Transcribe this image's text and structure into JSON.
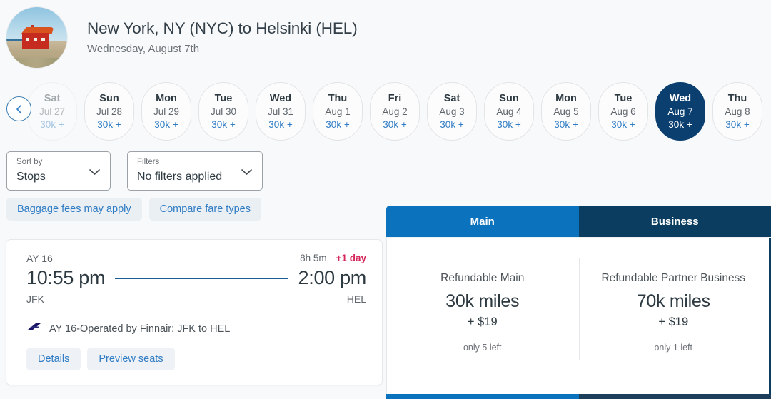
{
  "header": {
    "avatar_alt": "red-cabin-beach-photo",
    "route_title": "New York, NY (NYC) to Helsinki (HEL)",
    "route_date": "Wednesday, August 7th"
  },
  "carousel": {
    "prev_icon": "chevron-left-icon",
    "dates": [
      {
        "dow": "Sat",
        "day": "Jul 27",
        "price": "30k +",
        "selected": false,
        "faded": true
      },
      {
        "dow": "Sun",
        "day": "Jul 28",
        "price": "30k +",
        "selected": false,
        "faded": false
      },
      {
        "dow": "Mon",
        "day": "Jul 29",
        "price": "30k +",
        "selected": false,
        "faded": false
      },
      {
        "dow": "Tue",
        "day": "Jul 30",
        "price": "30k +",
        "selected": false,
        "faded": false
      },
      {
        "dow": "Wed",
        "day": "Jul 31",
        "price": "30k +",
        "selected": false,
        "faded": false
      },
      {
        "dow": "Thu",
        "day": "Aug 1",
        "price": "30k +",
        "selected": false,
        "faded": false
      },
      {
        "dow": "Fri",
        "day": "Aug 2",
        "price": "30k +",
        "selected": false,
        "faded": false
      },
      {
        "dow": "Sat",
        "day": "Aug 3",
        "price": "30k +",
        "selected": false,
        "faded": false
      },
      {
        "dow": "Sun",
        "day": "Aug 4",
        "price": "30k +",
        "selected": false,
        "faded": false
      },
      {
        "dow": "Mon",
        "day": "Aug 5",
        "price": "30k +",
        "selected": false,
        "faded": false
      },
      {
        "dow": "Tue",
        "day": "Aug 6",
        "price": "30k +",
        "selected": false,
        "faded": false
      },
      {
        "dow": "Wed",
        "day": "Aug 7",
        "price": "30k +",
        "selected": true,
        "faded": false
      },
      {
        "dow": "Thu",
        "day": "Aug 8",
        "price": "30k +",
        "selected": false,
        "faded": false
      }
    ]
  },
  "controls": {
    "sort": {
      "label": "Sort by",
      "value": "Stops",
      "icon": "chevron-down-icon"
    },
    "filters": {
      "label": "Filters",
      "value": "No filters applied",
      "icon": "chevron-down-icon"
    },
    "links": [
      {
        "label": "Baggage fees may apply"
      },
      {
        "label": "Compare fare types"
      }
    ]
  },
  "flight": {
    "flight_number": "AY 16",
    "duration": "8h 5m",
    "day_offset": "+1 day",
    "depart_time": "10:55 pm",
    "arrive_time": "2:00 pm",
    "depart_code": "JFK",
    "arrive_code": "HEL",
    "operator_icon": "finnair-logo-icon",
    "operated_by": "AY 16-Operated by Finnair: JFK to HEL",
    "details_label": "Details",
    "preview_seats_label": "Preview seats"
  },
  "fares": {
    "tabs": [
      {
        "label": "Main"
      },
      {
        "label": "Business"
      }
    ],
    "options": [
      {
        "name": "Refundable Main",
        "miles": "30k miles",
        "cash": "+ $19",
        "seats_left": "only 5 left"
      },
      {
        "name": "Refundable Partner Business",
        "miles": "70k miles",
        "cash": "+ $19",
        "seats_left": "only 1 left"
      }
    ]
  },
  "colors": {
    "page_bg": "#f7f9fa",
    "selected_date_bg": "#0a3f70",
    "main_tab_bg": "#0b72bd",
    "business_tab_bg": "#0a3d5f",
    "link_blue": "#2f7cc4",
    "alert_red": "#d6255a",
    "route_line": "#1a5c94"
  }
}
